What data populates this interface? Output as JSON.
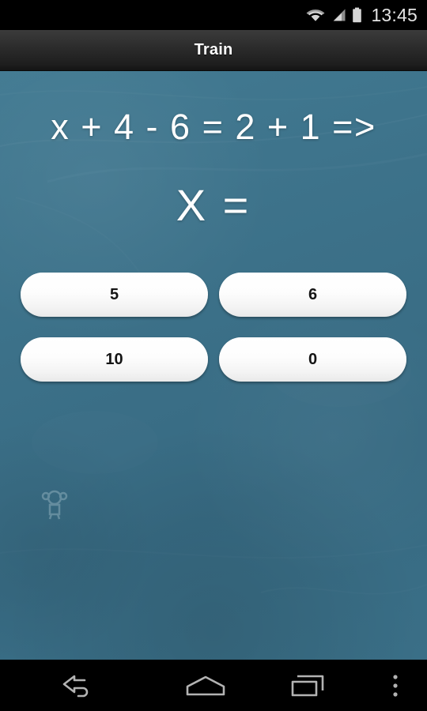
{
  "status_bar": {
    "time": "13:45",
    "icons": [
      "wifi-icon",
      "cellular-signal-icon",
      "battery-icon"
    ]
  },
  "action_bar": {
    "title": "Train"
  },
  "board": {
    "equation": "x + 4 - 6 = 2 + 1 =>",
    "unknown_prompt": "X =",
    "background_color": "#3c7189",
    "doodle": "chalk-doodle"
  },
  "answers": [
    {
      "label": "5"
    },
    {
      "label": "6"
    },
    {
      "label": "10"
    },
    {
      "label": "0"
    }
  ],
  "nav_bar": {
    "back": "back-icon",
    "home": "home-icon",
    "recents": "recents-icon",
    "overflow": "overflow-menu-icon"
  }
}
